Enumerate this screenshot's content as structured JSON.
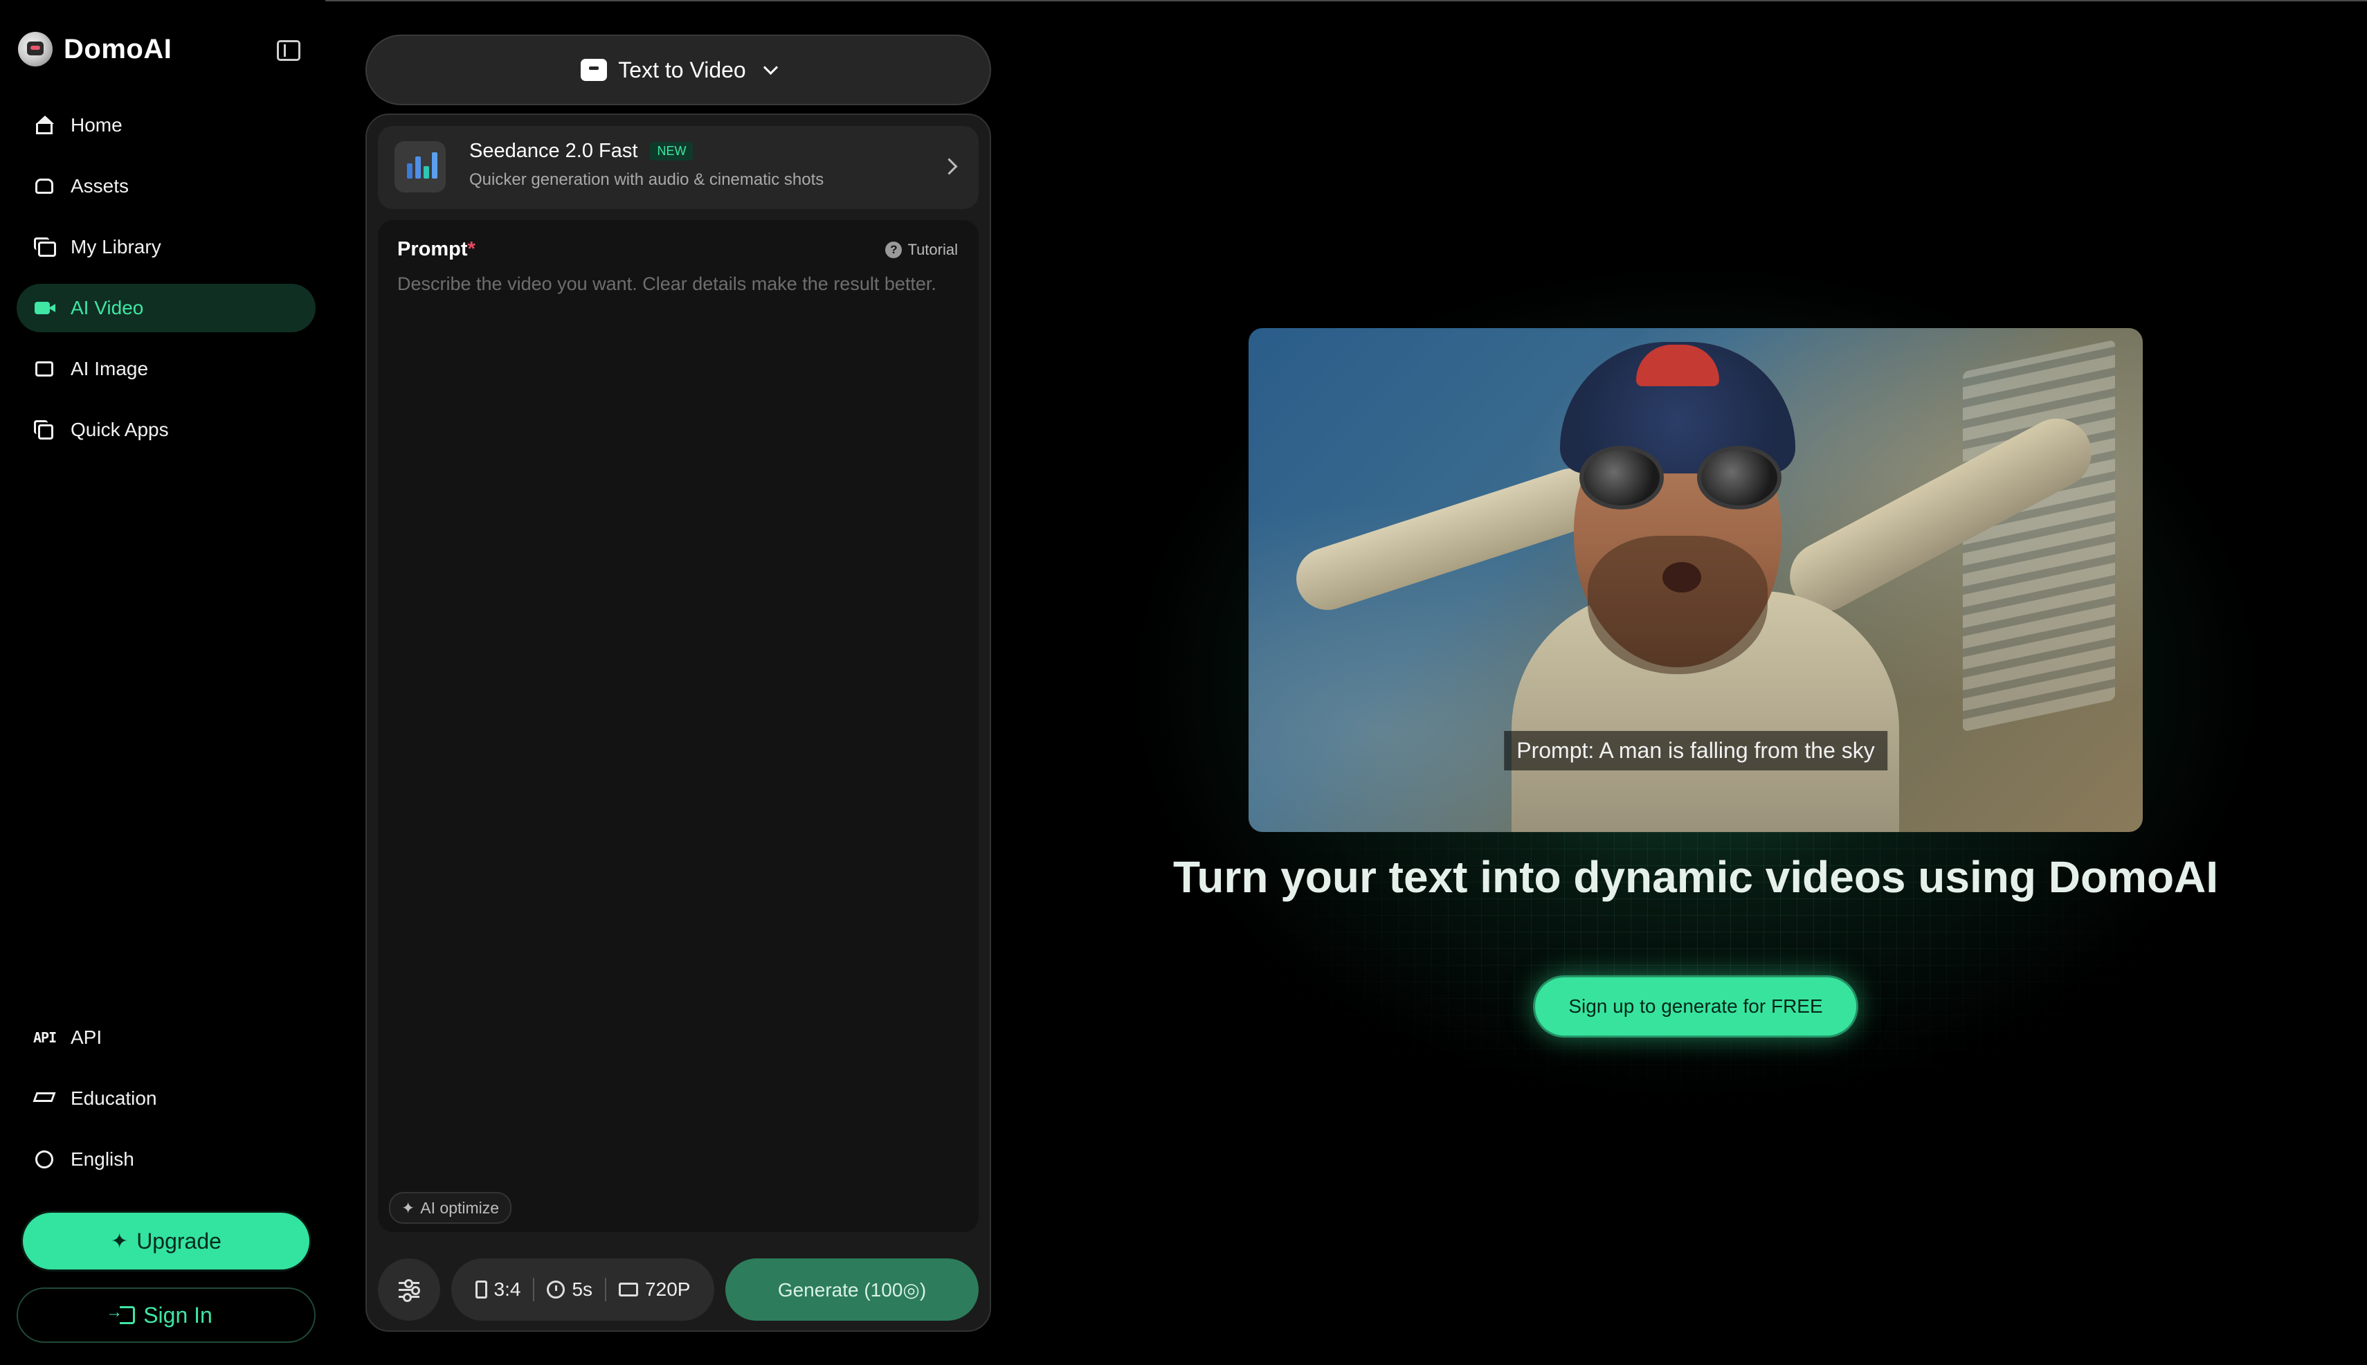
{
  "brand": {
    "name": "DomoAI"
  },
  "sidebar": {
    "items": [
      {
        "label": "Home",
        "icon": "home-icon"
      },
      {
        "label": "Assets",
        "icon": "assets-icon"
      },
      {
        "label": "My Library",
        "icon": "library-icon"
      },
      {
        "label": "AI Video",
        "icon": "video-camera-icon",
        "active": true
      },
      {
        "label": "AI Image",
        "icon": "image-icon"
      },
      {
        "label": "Quick Apps",
        "icon": "apps-icon"
      }
    ],
    "bottom_items": [
      {
        "label": "API",
        "icon": "api-icon"
      },
      {
        "label": "Education",
        "icon": "graduation-cap-icon"
      },
      {
        "label": "English",
        "icon": "globe-icon"
      }
    ],
    "upgrade_label": "Upgrade",
    "signin_label": "Sign In"
  },
  "mode": {
    "label": "Text to Video"
  },
  "model": {
    "name": "Seedance 2.0 Fast",
    "badge": "NEW",
    "description": "Quicker generation with audio & cinematic shots"
  },
  "prompt": {
    "label": "Prompt",
    "required_mark": "*",
    "tutorial_label": "Tutorial",
    "placeholder": "Describe the video you want. Clear details make the result better.",
    "value": ""
  },
  "ai_optimize_label": "AI optimize",
  "params": {
    "aspect": "3:4",
    "duration": "5s",
    "resolution": "720P"
  },
  "generate_label": "Generate (100◎)",
  "hero": {
    "caption": "Prompt: A man is falling from the sky",
    "title": "Turn your text into dynamic videos using DomoAI",
    "cta_label": "Sign up to generate for FREE"
  },
  "colors": {
    "accent": "#33e3a0",
    "active_nav_bg": "#0f2f23",
    "generate_bg": "#2d7c5c"
  }
}
